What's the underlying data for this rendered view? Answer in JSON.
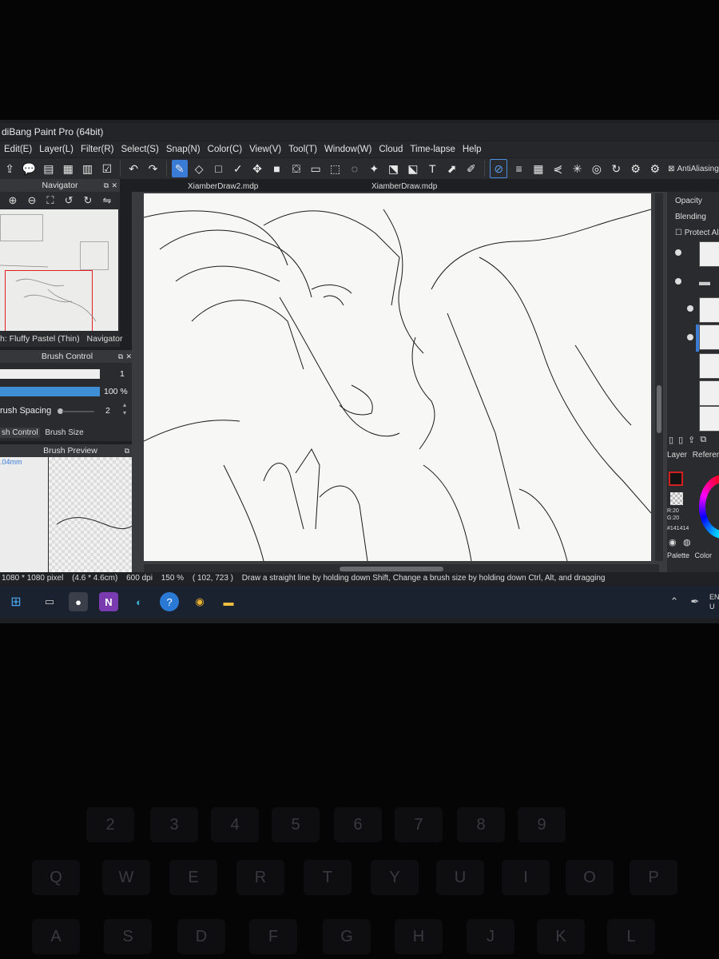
{
  "window": {
    "title": "diBang Paint Pro (64bit)"
  },
  "menu": [
    "Edit(E)",
    "Layer(L)",
    "Filter(R)",
    "Select(S)",
    "Snap(N)",
    "Color(C)",
    "View(V)",
    "Tool(T)",
    "Window(W)",
    "Cloud",
    "Time-lapse",
    "Help"
  ],
  "toolbar": {
    "antialias_label": "AntiAliasing"
  },
  "tabs": [
    "XiamberDraw2.mdp",
    "XiamberDraw.mdp"
  ],
  "navigator": {
    "title": "Navigator",
    "brush_name": "h: Fluffy Pastel (Thin)",
    "tab_label": "Navigator"
  },
  "brush_control": {
    "title": "Brush Control",
    "size_value": "1",
    "opacity_value": "100 %",
    "opacity_fraction": 1.0,
    "spacing_label": "rush Spacing",
    "spacing_value": "2",
    "tab_control": "sh Control",
    "tab_size": "Brush Size"
  },
  "brush_preview": {
    "title": "Brush Preview",
    "size_text": ".04mm"
  },
  "right_panel": {
    "opacity_label": "Opacity",
    "blending_label": "Blending",
    "protect_label": "Protect Alp",
    "layer_tab": "Layer",
    "reference_tab": "Reference",
    "color_r": "R:20",
    "color_g": "G:20",
    "color_hex": "#141414",
    "palette_tab": "Palette",
    "color_tab": "Color"
  },
  "status": {
    "size": "1080 * 1080 pixel",
    "cm": "(4.6 * 4.6cm)",
    "dpi": "600 dpi",
    "zoom": "150 %",
    "coords": "( 102, 723 )",
    "hint": "Draw a straight line by holding down Shift, Change a brush size by holding down Ctrl, Alt, and dragging"
  },
  "taskbar": {
    "lang1": "EN",
    "lang2": "U"
  },
  "keyboard": {
    "row1": [
      "2",
      "3",
      "4",
      "5",
      "6",
      "7",
      "8",
      "9"
    ],
    "row2": [
      "Q",
      "W",
      "E",
      "R",
      "T",
      "Y",
      "U",
      "I",
      "O",
      "P"
    ],
    "row3": [
      "A",
      "S",
      "D",
      "F",
      "G",
      "H",
      "J",
      "K",
      "L"
    ]
  },
  "colors": {
    "accent": "#3a7bd5",
    "foreground": "#141414"
  }
}
